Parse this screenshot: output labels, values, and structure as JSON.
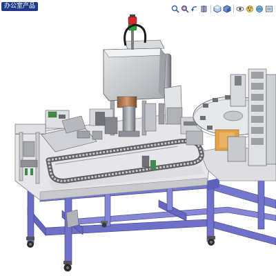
{
  "model_tab": {
    "label": "办公室产品"
  },
  "heads_up_toolbar": {
    "buttons": [
      {
        "icon": "zoom-to-fit-icon"
      },
      {
        "icon": "zoom-to-area-icon"
      },
      {
        "icon": "previous-view-icon"
      },
      {
        "icon": "section-view-icon"
      },
      {
        "icon": "view-orientation-icon"
      },
      {
        "icon": "display-style-icon"
      },
      {
        "icon": "hide-show-items-icon"
      },
      {
        "icon": "edit-appearance-icon"
      },
      {
        "icon": "apply-scene-icon"
      },
      {
        "icon": "view-settings-icon"
      }
    ]
  },
  "colors": {
    "frame_blue": "#6f71c9",
    "frame_blue_dark": "#4b4da3",
    "frame_blue_light": "#9a9be0",
    "tabletop": "#e9e9ea",
    "machine_grey": "#b9bcc2",
    "housing_grey": "#d4d6da",
    "stack_light_red": "#d2262c",
    "stack_light_green": "#2e9b3c",
    "tab_blue": "#1f3a8a",
    "accent_orange": "#e2a24a"
  }
}
